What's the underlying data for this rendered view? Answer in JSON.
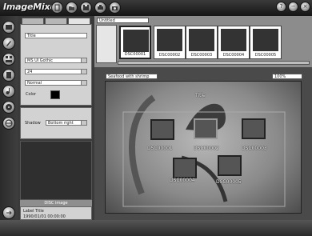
{
  "app": {
    "title": "ImageMixer"
  },
  "panel": {
    "title_field": "Title",
    "font_value": "MS UI Gothic",
    "size_value": "24",
    "style_value": "Normal",
    "color_label": "Color",
    "shadow_label": "Shadow",
    "shadow_value": "Bottom right",
    "header_label": "DISC image",
    "info_line1": "Label Title",
    "info_line2": "1990/01/01 00:00:00"
  },
  "album": {
    "selector": "Untitled"
  },
  "thumbnails": [
    "DSC00001",
    "DSC00002",
    "DSC00003",
    "DSC00004",
    "DSC00005"
  ],
  "canvas": {
    "template": "Seafood with shrimp",
    "zoom": "100%",
    "title": "Title",
    "photos": [
      "DSC00001",
      "DSC00002",
      "DSC00003",
      "DSC00004",
      "DSC00005"
    ]
  }
}
